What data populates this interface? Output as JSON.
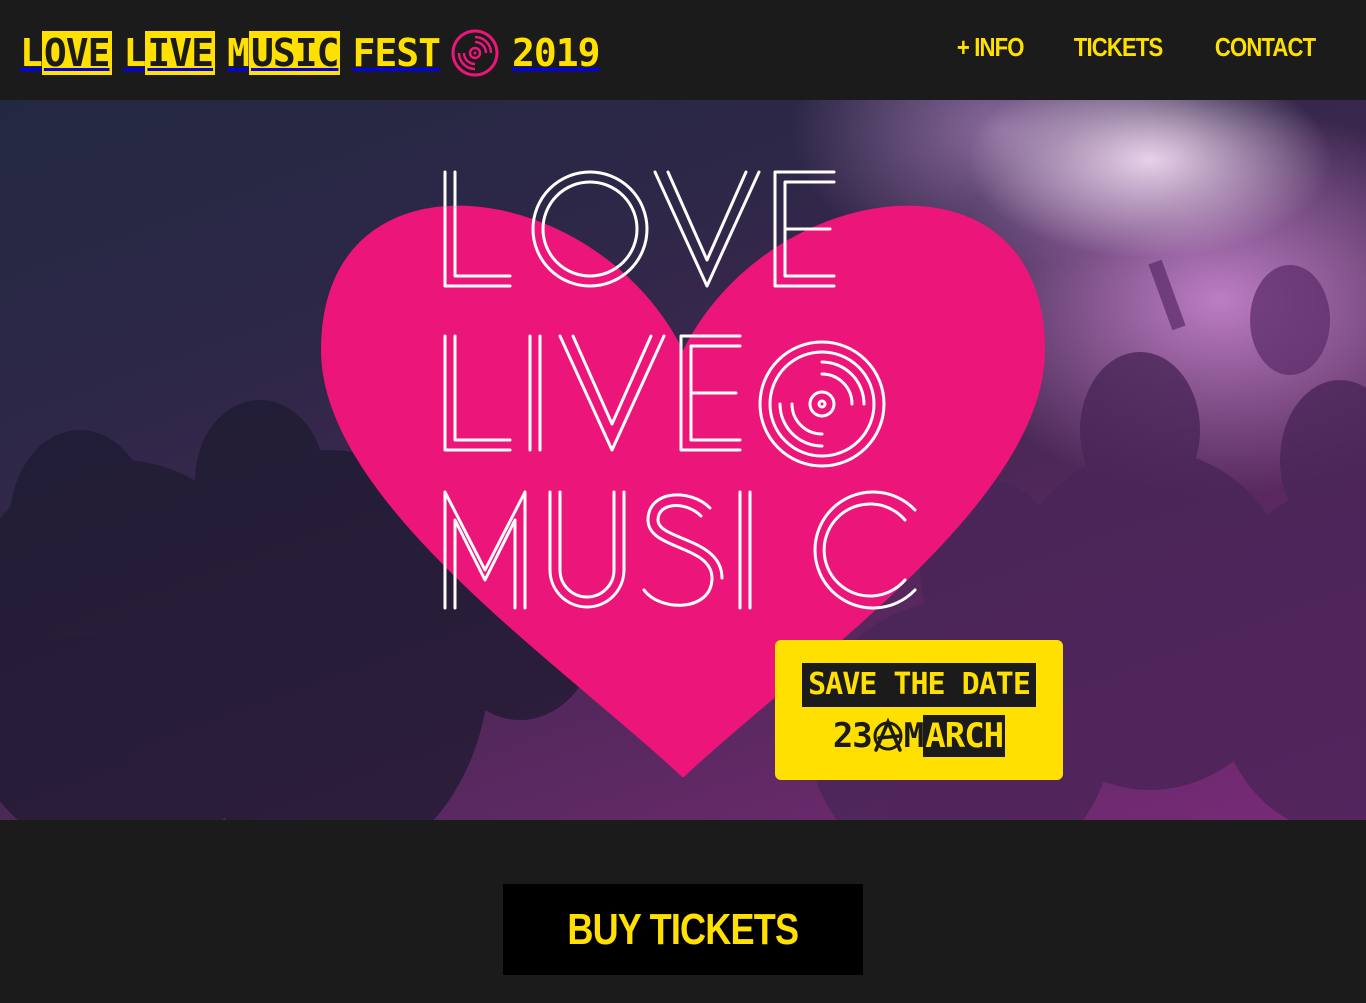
{
  "colors": {
    "brand_yellow": "#ffe000",
    "heart_pink": "#ec157a",
    "background_dark": "#1b1b1b",
    "button_black": "#000000",
    "logo_white": "#ffffff"
  },
  "header": {
    "logo": {
      "word1": {
        "prefix": "L",
        "highlight": "OVE"
      },
      "word2": {
        "prefix": "L",
        "highlight": "IVE"
      },
      "word3": {
        "prefix": "M",
        "highlight": "USIC"
      },
      "fest": "FEST",
      "icon": "vinyl-record-icon",
      "year": "2019"
    },
    "nav": [
      {
        "label": "+ INFO"
      },
      {
        "label": "TICKETS"
      },
      {
        "label": "CONTACT"
      }
    ]
  },
  "hero": {
    "heart_logo_lines": [
      "LOVE",
      "LIVE",
      "MUSIC"
    ],
    "heart_icon": "vinyl-record-icon",
    "save_the_date": {
      "line1": "SAVE THE DATE",
      "day": "23",
      "month_prefix": "M",
      "month_highlight": "ARCH",
      "icon": "anarchy-a-icon"
    }
  },
  "cta": {
    "buy_label": "BUY TICKETS"
  }
}
